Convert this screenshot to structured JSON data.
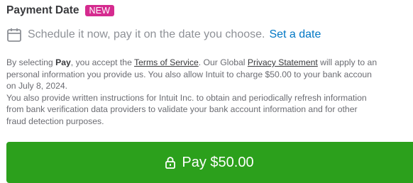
{
  "header": {
    "title": "Payment Date",
    "badge": "NEW"
  },
  "schedule": {
    "icon": "calendar-icon",
    "text": "Schedule it now, pay it on the date you choose.",
    "link": "Set a date"
  },
  "legal": {
    "line1_a": "By selecting ",
    "line1_pay": "Pay",
    "line1_b": ", you accept the ",
    "terms_link": "Terms of Service",
    "line1_c": ". Our Global ",
    "privacy_link": "Privacy Statement",
    "line1_d": " will apply to an",
    "line2": "personal information you provide us. You also allow Intuit to charge $50.00 to your bank accoun",
    "line3": "on July 8, 2024.",
    "line4": "You also provide written instructions for Intuit Inc. to obtain and periodically refresh information",
    "line5": "from bank verification data providers to validate your bank account information and for other",
    "line6": "fraud detection purposes."
  },
  "pay_button": {
    "icon": "lock-icon",
    "label": "Pay $50.00"
  },
  "colors": {
    "badge": "#d52b8f",
    "link": "#0077c5",
    "button": "#2ca01c"
  }
}
